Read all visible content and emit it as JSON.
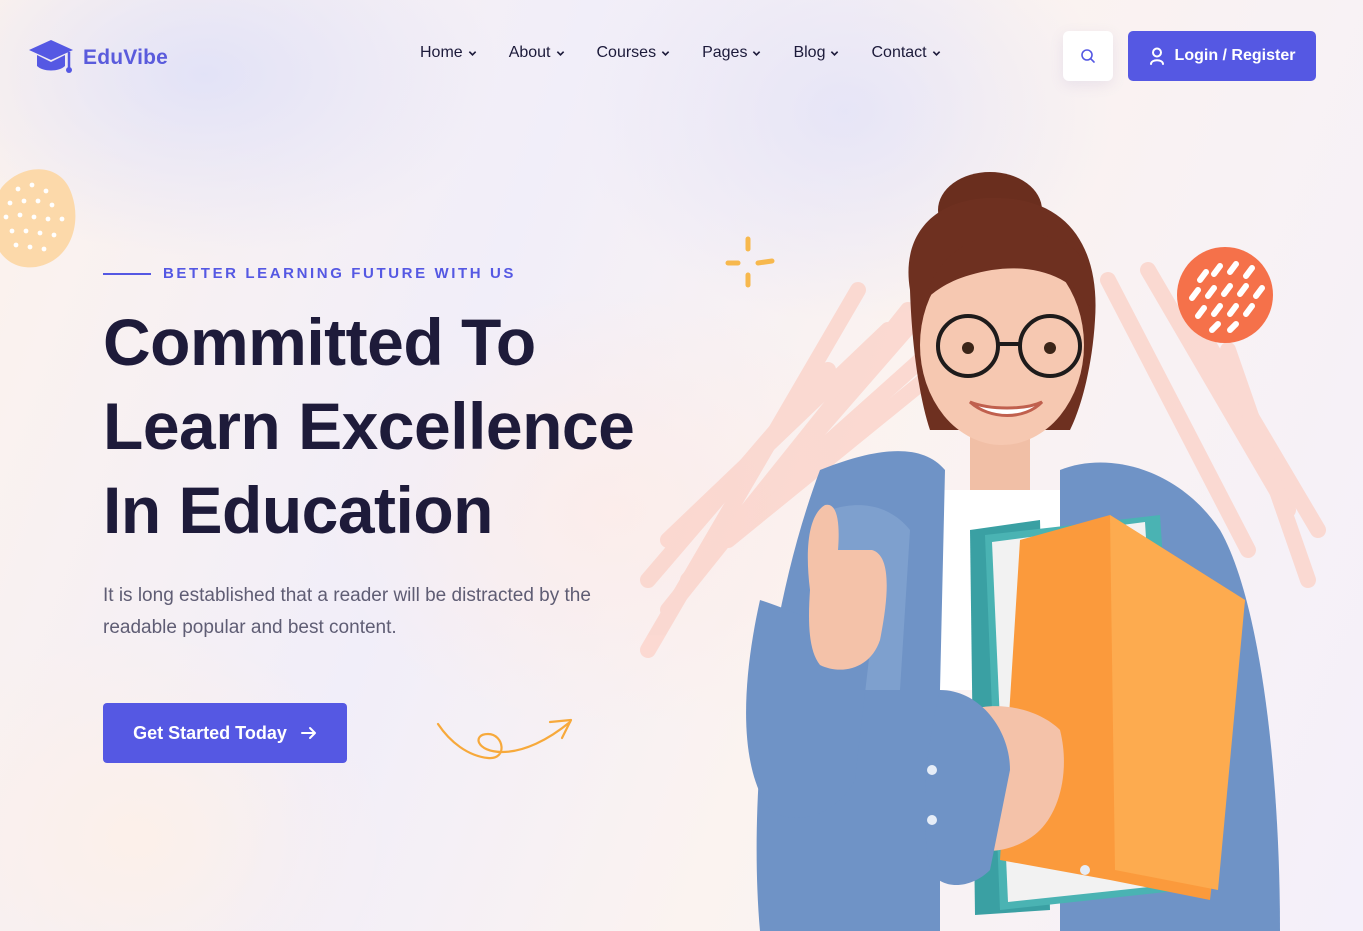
{
  "brand": {
    "name": "EduVibe",
    "logo_icon": "graduation-cap-icon"
  },
  "nav": {
    "items": [
      {
        "label": "Home"
      },
      {
        "label": "About"
      },
      {
        "label": "Courses"
      },
      {
        "label": "Pages"
      },
      {
        "label": "Blog"
      },
      {
        "label": "Contact"
      }
    ]
  },
  "header": {
    "search_icon": "search-icon",
    "login_label": "Login / Register",
    "login_icon": "user-icon"
  },
  "hero": {
    "eyebrow": "BETTER LEARNING FUTURE WITH US",
    "title_lines": [
      "Committed To",
      "Learn Excellence",
      "In Education"
    ],
    "description": "It is long established that a reader will be distracted by the readable popular and best content.",
    "cta_label": "Get Started Today",
    "cta_icon": "arrow-right-icon"
  },
  "colors": {
    "accent": "#5558e3",
    "heading": "#1e1b3a",
    "body_text": "#5f5d74",
    "decor_orange": "#f5714a",
    "decor_peach": "#fbd3a2"
  }
}
